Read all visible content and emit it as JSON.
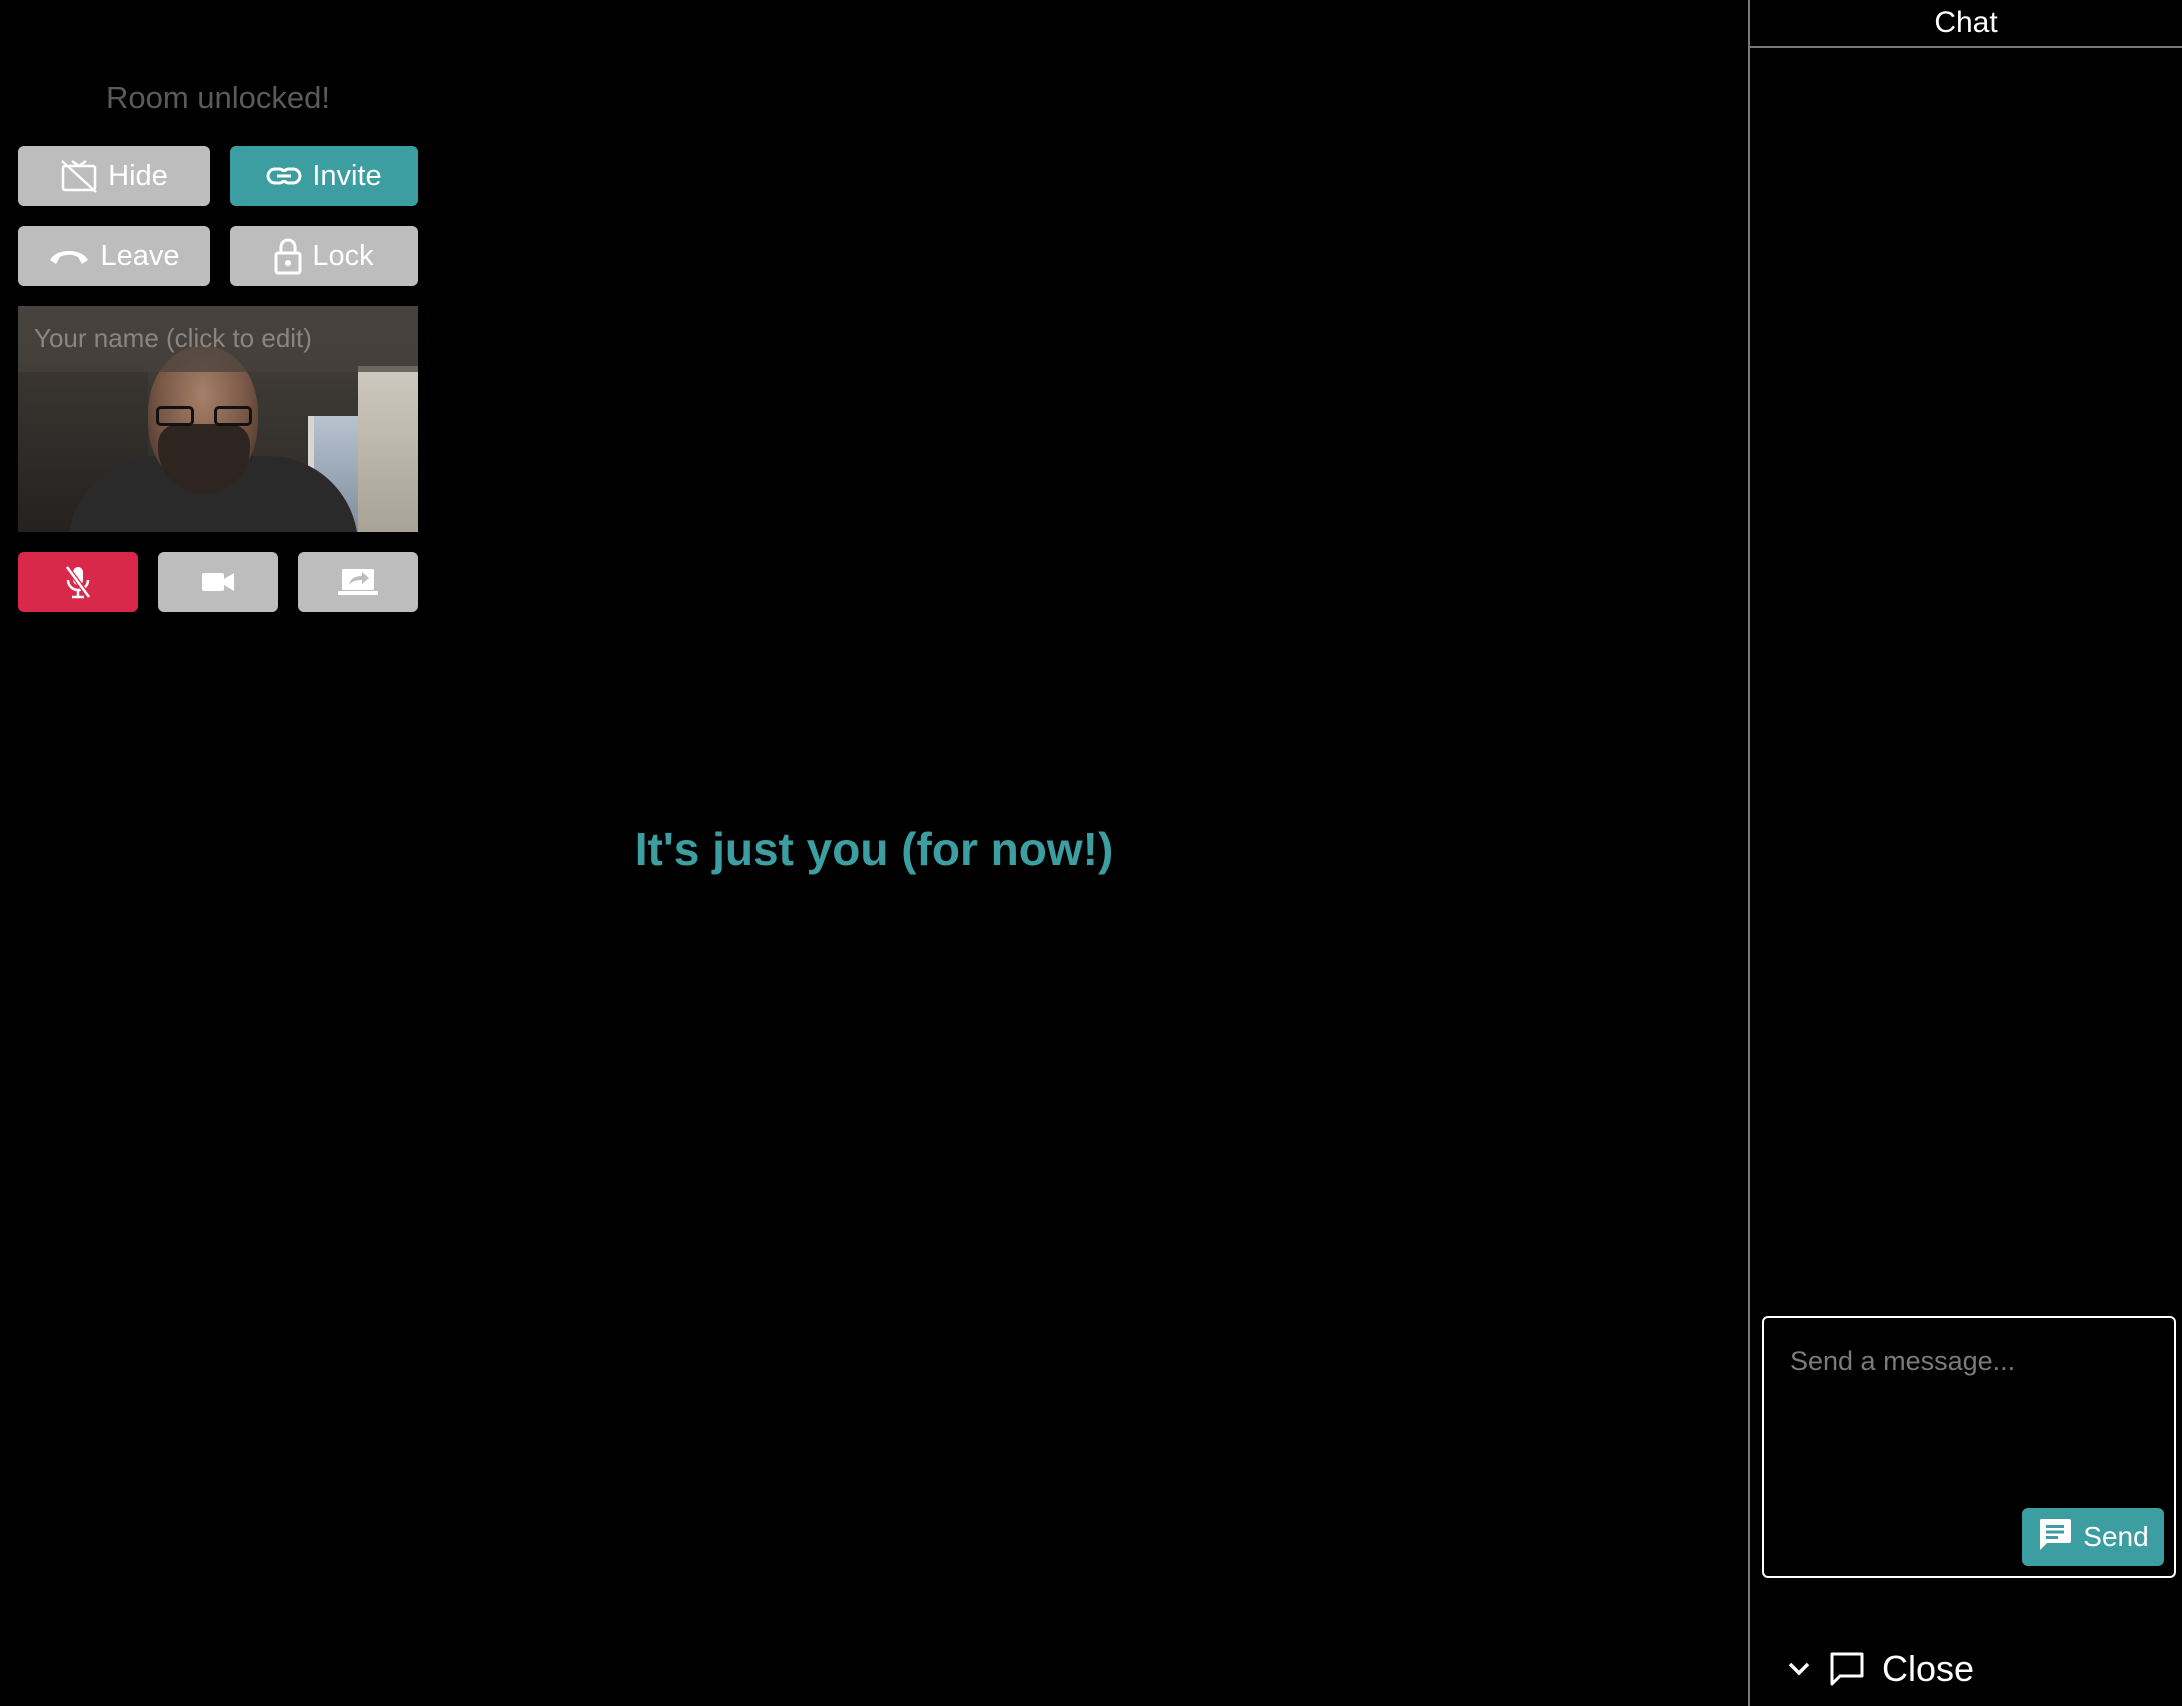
{
  "room": {
    "status": "Room unlocked!"
  },
  "controls": {
    "hide_label": "Hide",
    "invite_label": "Invite",
    "leave_label": "Leave",
    "lock_label": "Lock"
  },
  "self_video": {
    "name_placeholder": "Your name (click to edit)",
    "name_value": ""
  },
  "media": {
    "mic": "muted",
    "camera": "on",
    "screen_share": "off"
  },
  "main": {
    "empty_message": "It's just you (for now!)"
  },
  "chat": {
    "title": "Chat",
    "input_placeholder": "Send a message...",
    "send_label": "Send",
    "close_label": "Close"
  },
  "colors": {
    "accent_teal": "#3d9ea2",
    "danger_red": "#d8294b",
    "button_gray": "#bdbdbd",
    "background": "#000000"
  }
}
